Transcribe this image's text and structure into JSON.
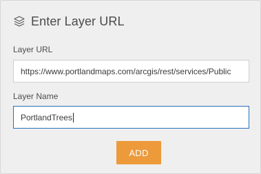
{
  "dialog": {
    "title": "Enter Layer URL",
    "title_icon": "layers-icon"
  },
  "layer_url": {
    "label": "Layer URL",
    "value": "https://www.portlandmaps.com/arcgis/rest/services/Public"
  },
  "layer_name": {
    "label": "Layer Name",
    "value": "PortlandTrees"
  },
  "actions": {
    "add_label": "ADD"
  },
  "colors": {
    "panel_bg": "#efefef",
    "accent_button": "#ed9a3b",
    "focused_border": "#2a6fb8"
  }
}
